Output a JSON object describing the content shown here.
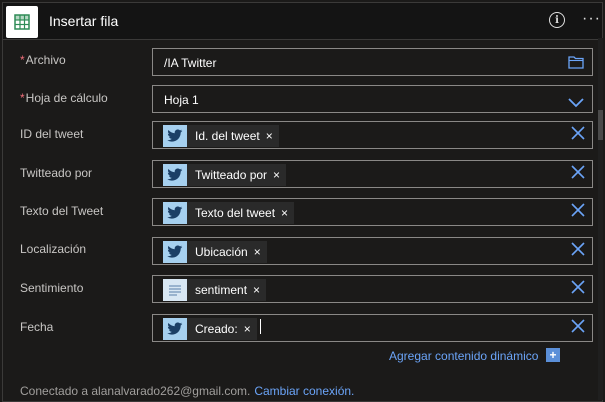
{
  "header": {
    "title": "Insertar fila",
    "icon": "excel-table-icon",
    "info_icon_glyph": "i",
    "more_glyph": "···"
  },
  "fields": [
    {
      "label": "Archivo",
      "required": true,
      "value": "/IA Twitter",
      "control": "folder-picker"
    },
    {
      "label": "Hoja de cálculo",
      "required": true,
      "value": "Hoja 1",
      "control": "dropdown"
    },
    {
      "label": "ID del tweet",
      "required": false,
      "token": "Id. del tweet",
      "token_source": "twitter"
    },
    {
      "label": "Twitteado por",
      "required": false,
      "token": "Twitteado por",
      "token_source": "twitter"
    },
    {
      "label": "Texto del Tweet",
      "required": false,
      "token": "Texto del tweet",
      "token_source": "twitter"
    },
    {
      "label": "Localización",
      "required": false,
      "token": "Ubicación",
      "token_source": "twitter"
    },
    {
      "label": "Sentimiento",
      "required": false,
      "token": "sentiment",
      "token_source": "text-analytics"
    },
    {
      "label": "Fecha",
      "required": false,
      "token": "Creado:",
      "token_source": "twitter"
    }
  ],
  "required_mark": "*",
  "token_remove_glyph": "×",
  "dynamic_content": {
    "label": "Agregar contenido dinámico",
    "plus": "+"
  },
  "footer": {
    "connected_text": "Conectado a alanalvarado262@gmail.com.",
    "change_link": "Cambiar conexión."
  },
  "colors": {
    "accent": "#6ba4f8",
    "required": "#f1707b",
    "twitter_token": "#a6d0ef",
    "background": "#1b1a19"
  }
}
